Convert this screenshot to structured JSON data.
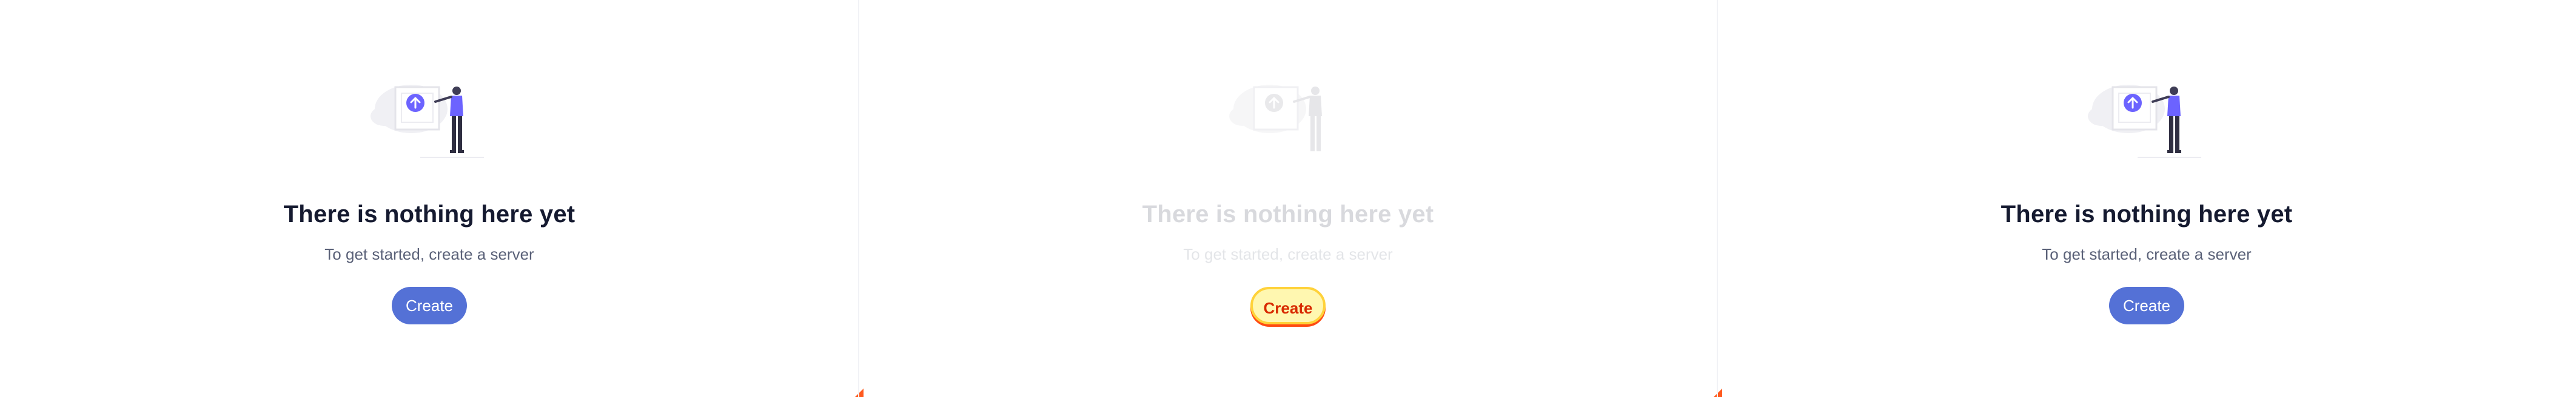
{
  "panels": [
    {
      "title": "There is nothing here yet",
      "subtitle": "To get started, create a server",
      "button_label": "Create"
    },
    {
      "title": "There is nothing here yet",
      "subtitle": "To get started, create a server",
      "button_label": "Create"
    },
    {
      "title": "There is nothing here yet",
      "subtitle": "To get started, create a server",
      "button_label": "Create"
    }
  ],
  "icons": {
    "upload": "upload-arrow-icon",
    "person": "person-illustration-icon"
  },
  "colors": {
    "accent": "#5471d6",
    "illustration_accent": "#6c63ff",
    "highlight_bg": "#fff7b0",
    "highlight_text": "#d82a00"
  }
}
